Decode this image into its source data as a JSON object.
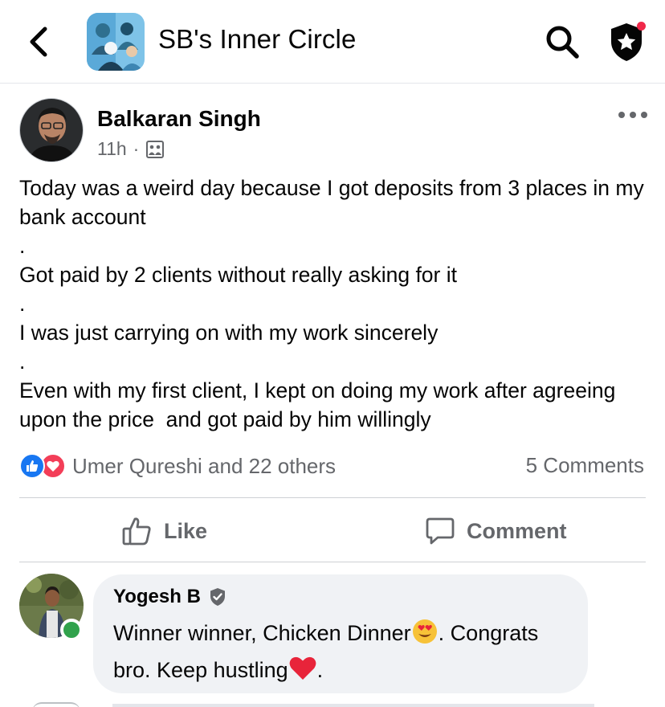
{
  "header": {
    "title": "SB's Inner Circle",
    "back_icon": "chevron-left-icon",
    "search_icon": "search-icon",
    "admin_icon": "shield-star-icon"
  },
  "post": {
    "author": "Balkaran Singh",
    "time": "11h",
    "separator": "·",
    "audience_icon": "group-icon",
    "paragraphs": [
      "Today was a weird day because I got deposits from 3 places in my bank account",
      ".",
      "Got paid by 2 clients without really asking for it",
      ".",
      "I was just carrying on with my work sincerely",
      ".",
      "Even with my first client, I kept on doing my work after agreeing upon the price  and got paid by him willingly"
    ],
    "reactions_text": "Umer Qureshi and 22 others",
    "comments_count": "5 Comments"
  },
  "actions": {
    "like_label": "Like",
    "comment_label": "Comment"
  },
  "comment": {
    "author": "Yogesh B",
    "text_part1": "Winner winner, Chicken Dinner",
    "text_part2": ". Congrats bro. Keep hustling",
    "text_part3": "."
  },
  "colors": {
    "like_blue": "#1877f2",
    "love_red": "#f33e58",
    "online_green": "#31a24c",
    "notification_red": "#f02849",
    "muted_text": "#65676b",
    "bubble_bg": "#f0f2f5"
  }
}
